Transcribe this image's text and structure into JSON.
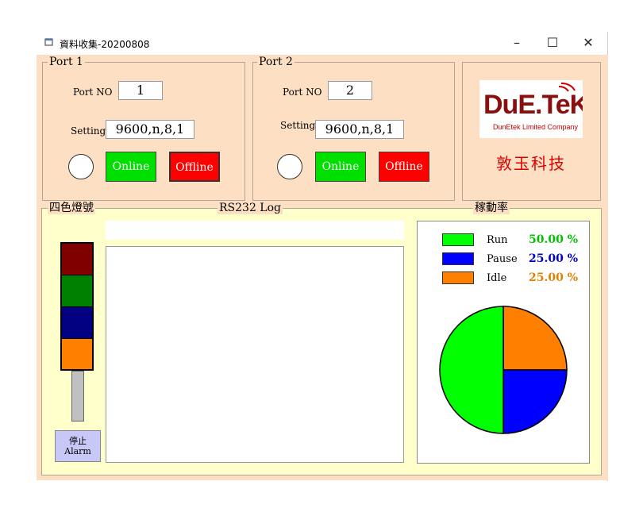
{
  "window": {
    "title": "資料收集-20200808",
    "minimize": "–",
    "maximize": "☐",
    "close": "✕"
  },
  "port1": {
    "title": "Port 1",
    "port_no_label": "Port NO",
    "port_no_value": "1",
    "setting_label": "Setting",
    "setting_value": "9600,n,8,1",
    "online_label": "Online",
    "offline_label": "Offline"
  },
  "port2": {
    "title": "Port 2",
    "port_no_label": "Port NO",
    "port_no_value": "2",
    "setting_label": "Setting",
    "setting_value": "9600,n,8,1",
    "online_label": "Online",
    "offline_label": "Offline"
  },
  "logo": {
    "brand": "DuE.TeK",
    "subtitle": "DunEtek Limited Company",
    "company_name": "敦玉科技"
  },
  "signal": {
    "title": "四色燈號",
    "colors": [
      "#800000",
      "#008000",
      "#000080",
      "#ff8000"
    ],
    "alarm_line1": "停止",
    "alarm_line2": "Alarm"
  },
  "log": {
    "title": "RS232 Log",
    "input_value": "",
    "content": ""
  },
  "utilization": {
    "title": "稼動率"
  },
  "chart_data": {
    "type": "pie",
    "title": "",
    "series": [
      {
        "name": "Run",
        "value": 50.0,
        "label": "50.00 %",
        "color": "#00ff00",
        "text_color": "#00c000"
      },
      {
        "name": "Pause",
        "value": 25.0,
        "label": "25.00 %",
        "color": "#0000ff",
        "text_color": "#0000c0"
      },
      {
        "name": "Idle",
        "value": 25.0,
        "label": "25.00 %",
        "color": "#ff8000",
        "text_color": "#e08000"
      }
    ]
  }
}
